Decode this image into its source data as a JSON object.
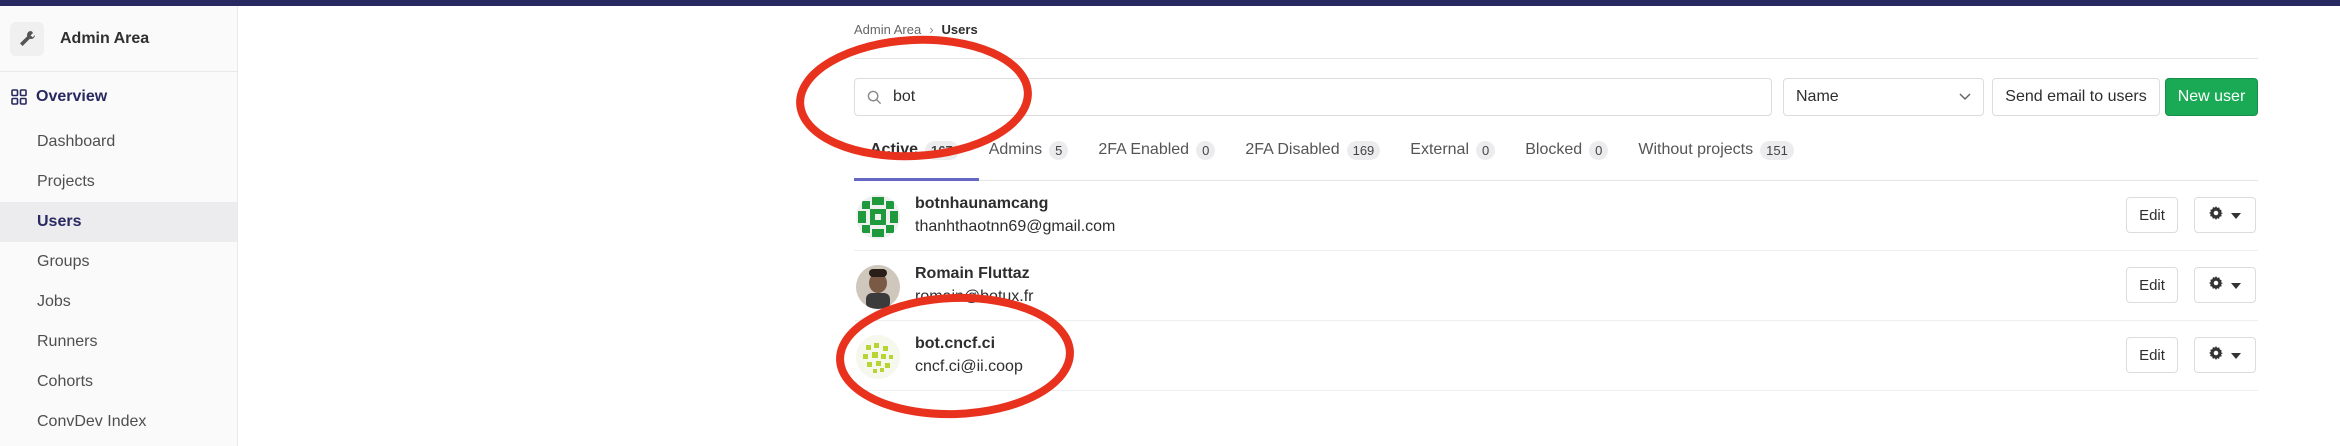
{
  "sidebar": {
    "title": "Admin Area",
    "section_label": "Overview",
    "items": [
      {
        "label": "Dashboard",
        "active": false
      },
      {
        "label": "Projects",
        "active": false
      },
      {
        "label": "Users",
        "active": true
      },
      {
        "label": "Groups",
        "active": false
      },
      {
        "label": "Jobs",
        "active": false
      },
      {
        "label": "Runners",
        "active": false
      },
      {
        "label": "Cohorts",
        "active": false
      },
      {
        "label": "ConvDev Index",
        "active": false
      }
    ]
  },
  "breadcrumb": {
    "parent": "Admin Area",
    "separator": "›",
    "current": "Users"
  },
  "search": {
    "value": "bot"
  },
  "sort": {
    "selected": "Name"
  },
  "actions": {
    "send_email": "Send email to users",
    "new_user": "New user"
  },
  "tabs": [
    {
      "label": "Active",
      "count": "167"
    },
    {
      "label": "Admins",
      "count": "5"
    },
    {
      "label": "2FA Enabled",
      "count": "0"
    },
    {
      "label": "2FA Disabled",
      "count": "169"
    },
    {
      "label": "External",
      "count": "0"
    },
    {
      "label": "Blocked",
      "count": "0"
    },
    {
      "label": "Without projects",
      "count": "151"
    }
  ],
  "users": [
    {
      "name": "botnhaunamcang",
      "email": "thanhthaotnn69@gmail.com",
      "edit": "Edit"
    },
    {
      "name": "Romain Fluttaz",
      "email": "romain@botux.fr",
      "edit": "Edit"
    },
    {
      "name": "bot.cncf.ci",
      "email": "cncf.ci@ii.coop",
      "edit": "Edit"
    }
  ],
  "colors": {
    "brand": "#292961",
    "accent_tab": "#6666c4",
    "new_user_green": "#1aaa55",
    "annotation_red": "#e8321e"
  }
}
